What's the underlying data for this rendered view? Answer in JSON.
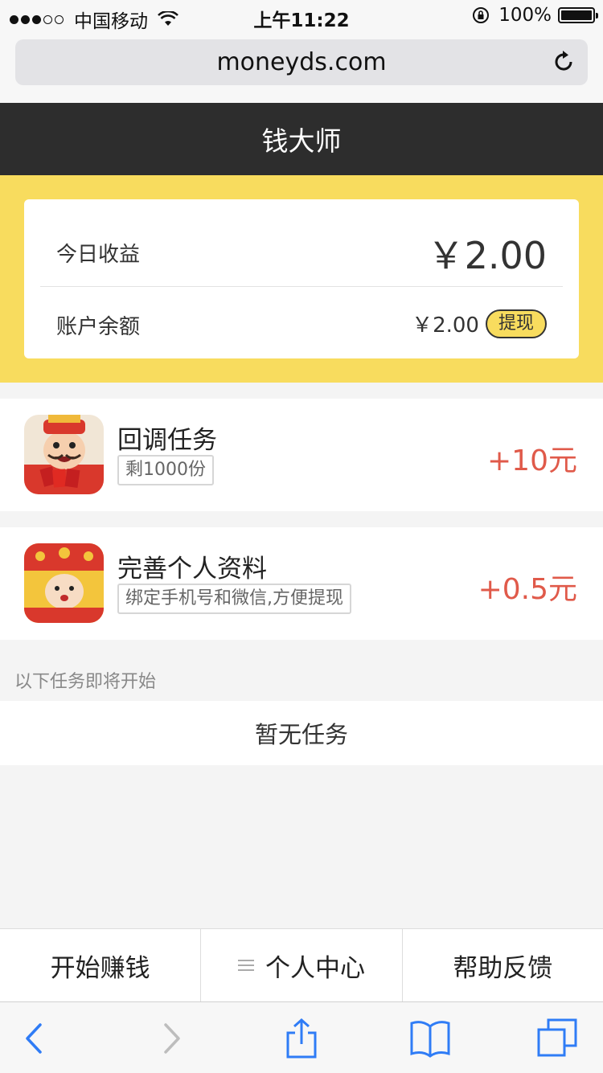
{
  "status_bar": {
    "carrier": "中国移动",
    "time": "上午11:22",
    "battery": "100%"
  },
  "browser": {
    "url": "moneyds.com"
  },
  "header": {
    "title": "钱大师"
  },
  "earnings": {
    "today_label": "今日收益",
    "today_amount": "￥2.00",
    "balance_label": "账户余额",
    "balance_amount": "￥2.00",
    "withdraw_label": "提现"
  },
  "tasks": [
    {
      "title": "回调任务",
      "tag": "剩1000份",
      "reward": "+10元"
    },
    {
      "title": "完善个人资料",
      "tag": "绑定手机号和微信,方便提现",
      "reward": "+0.5元"
    }
  ],
  "upcoming": {
    "label": "以下任务即将开始",
    "empty_text": "暂无任务"
  },
  "bottom_nav": {
    "items": [
      "开始赚钱",
      "个人中心",
      "帮助反馈"
    ]
  },
  "colors": {
    "accent_yellow": "#f8dc5e",
    "header_dark": "#2d2d2d",
    "reward_red": "#e05a4a",
    "ios_blue": "#2f7cf6"
  }
}
